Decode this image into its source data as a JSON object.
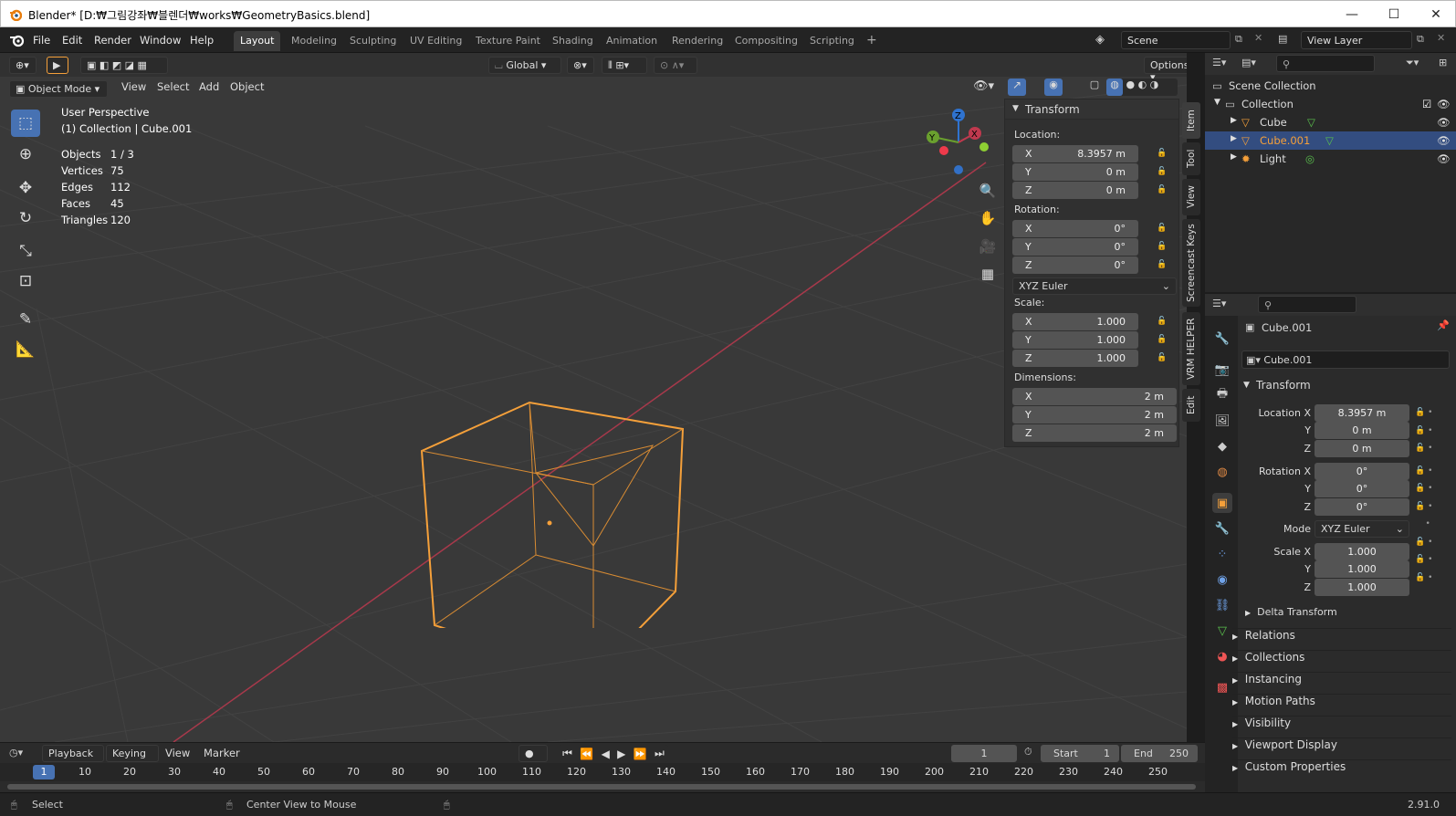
{
  "window": {
    "title": "Blender* [D:₩그림강좌₩블렌더₩works₩GeometryBasics.blend]",
    "minimize": "—",
    "maximize": "☐",
    "close": "✕"
  },
  "menu": {
    "items": [
      "File",
      "Edit",
      "Render",
      "Window",
      "Help"
    ]
  },
  "workspaces": [
    "Layout",
    "Modeling",
    "Sculpting",
    "UV Editing",
    "Texture Paint",
    "Shading",
    "Animation",
    "Rendering",
    "Compositing",
    "Scripting"
  ],
  "add_workspace": "+",
  "scene": {
    "name": "Scene",
    "view_layer": "View Layer"
  },
  "viewport": {
    "transform_orientation": "Global",
    "options_label": "Options",
    "mode": "Object Mode",
    "menus": [
      "View",
      "Select",
      "Add",
      "Object"
    ],
    "perspective": "User Perspective",
    "collection_info": "(1) Collection | Cube.001",
    "stats": [
      [
        "Objects",
        "1 / 3"
      ],
      [
        "Vertices",
        "75"
      ],
      [
        "Edges",
        "112"
      ],
      [
        "Faces",
        "45"
      ],
      [
        "Triangles",
        "120"
      ]
    ],
    "gizmo": {
      "x": "X",
      "y": "Y",
      "z": "Z"
    }
  },
  "npanel": {
    "header": "Transform",
    "location_label": "Location:",
    "location": [
      [
        "X",
        "8.3957 m"
      ],
      [
        "Y",
        "0 m"
      ],
      [
        "Z",
        "0 m"
      ]
    ],
    "rotation_label": "Rotation:",
    "rotation": [
      [
        "X",
        "0°"
      ],
      [
        "Y",
        "0°"
      ],
      [
        "Z",
        "0°"
      ]
    ],
    "rotation_mode": "XYZ Euler",
    "scale_label": "Scale:",
    "scale": [
      [
        "X",
        "1.000"
      ],
      [
        "Y",
        "1.000"
      ],
      [
        "Z",
        "1.000"
      ]
    ],
    "dimensions_label": "Dimensions:",
    "dimensions": [
      [
        "X",
        "2 m"
      ],
      [
        "Y",
        "2 m"
      ],
      [
        "Z",
        "2 m"
      ]
    ],
    "tabs": [
      "Item",
      "Tool",
      "View",
      "Screencast Keys",
      "VRM HELPER",
      "Edit"
    ]
  },
  "outliner": {
    "scene_collection": "Scene Collection",
    "items": [
      {
        "name": "Collection",
        "level": 1
      },
      {
        "name": "Cube",
        "level": 2
      },
      {
        "name": "Cube.001",
        "level": 2,
        "selected": true
      },
      {
        "name": "Light",
        "level": 2
      }
    ]
  },
  "properties": {
    "object_name": "Cube.001",
    "object_field": "Cube.001",
    "transform": "Transform",
    "location_label": "Location X",
    "location": [
      "8.3957 m",
      "0 m",
      "0 m"
    ],
    "rotation_label": "Rotation X",
    "rotation": [
      "0°",
      "0°",
      "0°"
    ],
    "mode_label": "Mode",
    "mode": "XYZ Euler",
    "scale_label": "Scale X",
    "scale": [
      "1.000",
      "1.000",
      "1.000"
    ],
    "axis_y": "Y",
    "axis_z": "Z",
    "delta": "Delta Transform",
    "sections": [
      "Relations",
      "Collections",
      "Instancing",
      "Motion Paths",
      "Visibility",
      "Viewport Display",
      "Custom Properties"
    ]
  },
  "timeline": {
    "menus": [
      "Playback",
      "Keying",
      "View",
      "Marker"
    ],
    "current_frame": "1",
    "start_label": "Start",
    "start": "1",
    "end_label": "End",
    "end": "250",
    "ticks": [
      "1",
      "10",
      "20",
      "30",
      "40",
      "50",
      "60",
      "70",
      "80",
      "90",
      "100",
      "110",
      "120",
      "130",
      "140",
      "150",
      "160",
      "170",
      "180",
      "190",
      "200",
      "210",
      "220",
      "230",
      "240",
      "250"
    ]
  },
  "status": {
    "select": "Select",
    "center": "Center View to Mouse",
    "version": "2.91.0"
  },
  "colors": {
    "accent": "#4772b3",
    "selected_object": "#f5a03a",
    "x_axis": "#c0394e",
    "brand": "#e87d0d"
  }
}
